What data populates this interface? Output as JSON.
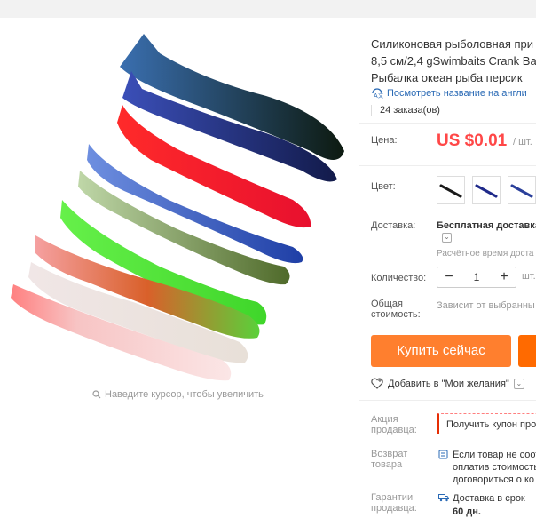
{
  "gallery": {
    "zoom_hint": "Наведите курсор, чтобы увеличить"
  },
  "product": {
    "title_lines": [
      "Силиконовая рыболовная при",
      "8,5 см/2,4 gSwimbaits Crank Ba",
      "Рыбалка океан рыба персик"
    ],
    "translate_link": "Посмотреть название на англи",
    "orders": "24 заказа(ов)"
  },
  "price": {
    "label": "Цена:",
    "value": "US $0.01",
    "unit": "/ шт."
  },
  "color": {
    "label": "Цвет:",
    "swatches": [
      "#1a1a1a",
      "#1f2a8a",
      "#2a3f9a"
    ]
  },
  "shipping": {
    "label": "Доставка:",
    "value": "Бесплатная доставка",
    "toggle_icon": "chevron-down-icon",
    "delivery_time": "Расчётное время доста"
  },
  "quantity": {
    "label": "Количество:",
    "minus": "−",
    "value": "1",
    "plus": "+",
    "unit": "шт."
  },
  "total": {
    "label_line1": "Общая",
    "label_line2": "стоимость:",
    "value": "Зависит от выбранны"
  },
  "actions": {
    "buy_now": "Купить сейчас",
    "wishlist": "Добавить в \"Мои желания\""
  },
  "seller_promo": {
    "label_line1": "Акция",
    "label_line2": "продавца:",
    "value": "Получить купон про"
  },
  "returns": {
    "label_line1": "Возврат",
    "label_line2": "товара",
    "line1": "Если товар не соот",
    "line2": "оплатив стоимость",
    "line3": "договориться о ко"
  },
  "guarantee": {
    "label_line1": "Гарантии",
    "label_line2": "продавца:",
    "line1": "Доставка в срок",
    "days": "60 дн."
  },
  "colors": {
    "accent_orange": "#ff7f2e",
    "price_red": "#ff4747",
    "link_blue": "#2a6ab5"
  }
}
